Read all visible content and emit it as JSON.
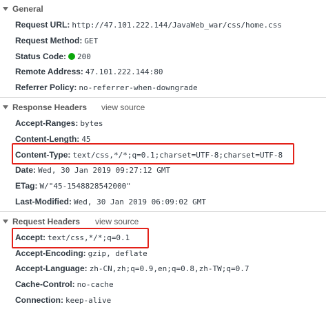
{
  "general": {
    "title": "General",
    "rows": [
      {
        "key": "Request URL:",
        "value": "http://47.101.222.144/JavaWeb_war/css/home.css"
      },
      {
        "key": "Request Method:",
        "value": "GET"
      },
      {
        "key": "Status Code:",
        "value": "200"
      },
      {
        "key": "Remote Address:",
        "value": "47.101.222.144:80"
      },
      {
        "key": "Referrer Policy:",
        "value": "no-referrer-when-downgrade"
      }
    ]
  },
  "response_headers": {
    "title": "Response Headers",
    "view_source": "view source",
    "rows": [
      {
        "key": "Accept-Ranges:",
        "value": "bytes"
      },
      {
        "key": "Content-Length:",
        "value": "45"
      },
      {
        "key": "Content-Type:",
        "value": "text/css,*/*;q=0.1;charset=UTF-8;charset=UTF-8"
      },
      {
        "key": "Date:",
        "value": "Wed, 30 Jan 2019 09:27:12 GMT"
      },
      {
        "key": "ETag:",
        "value": "W/\"45-1548828542000\""
      },
      {
        "key": "Last-Modified:",
        "value": "Wed, 30 Jan 2019 06:09:02 GMT"
      }
    ]
  },
  "request_headers": {
    "title": "Request Headers",
    "view_source": "view source",
    "rows": [
      {
        "key": "Accept:",
        "value": "text/css,*/*;q=0.1"
      },
      {
        "key": "Accept-Encoding:",
        "value": "gzip, deflate"
      },
      {
        "key": "Accept-Language:",
        "value": "zh-CN,zh;q=0.9,en;q=0.8,zh-TW;q=0.7"
      },
      {
        "key": "Cache-Control:",
        "value": "no-cache"
      },
      {
        "key": "Connection:",
        "value": "keep-alive"
      }
    ]
  },
  "colors": {
    "highlight": "#e32119",
    "status_ok": "#0ba70b"
  }
}
